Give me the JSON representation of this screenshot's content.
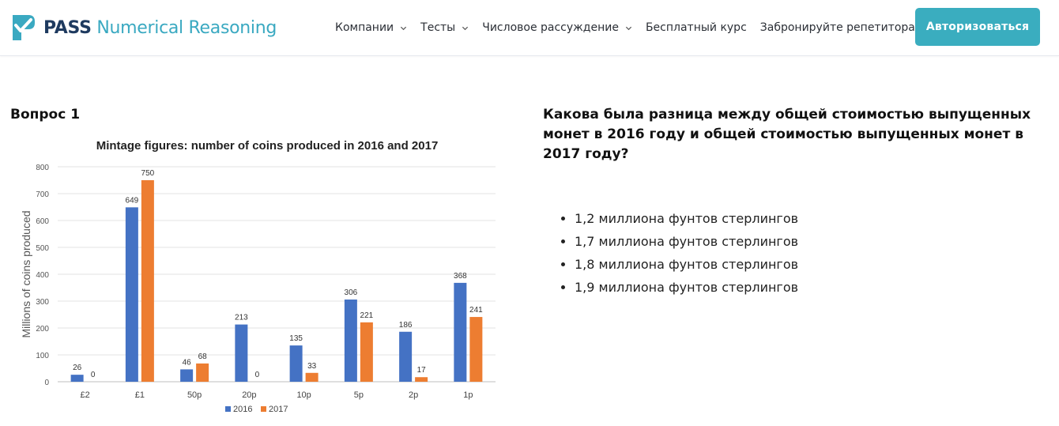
{
  "brand": {
    "pass": "PASS",
    "rest": "Numerical Reasoning",
    "accent": "#3aa9c1",
    "dark": "#1e3a5f"
  },
  "nav": [
    {
      "label": "Компании",
      "dropdown": true
    },
    {
      "label": "Тесты",
      "dropdown": true
    },
    {
      "label": "Числовое рассуждение",
      "dropdown": true
    },
    {
      "label": "Бесплатный курс",
      "dropdown": false
    },
    {
      "label": "Забронируйте репетитора",
      "dropdown": false
    }
  ],
  "login_label": "Авторизоваться",
  "question_label": "Вопрос 1",
  "question_text": "Какова была разница между общей стоимостью выпущенных монет в 2016 году и общей стоимостью выпущенных монет в 2017 году?",
  "answers": [
    "1,2 миллиона фунтов стерлингов",
    "1,7 миллиона фунтов стерлингов",
    "1,8 миллиона фунтов стерлингов",
    "1,9 миллиона фунтов стерлингов"
  ],
  "chart_data": {
    "type": "bar",
    "title": "Mintage figures:  number of coins produced in 2016 and 2017",
    "xlabel": "",
    "ylabel": "Millions of coins produced",
    "ylim": [
      0,
      800
    ],
    "yticks": [
      0,
      100,
      200,
      300,
      400,
      500,
      600,
      700,
      800
    ],
    "categories": [
      "£2",
      "£1",
      "50p",
      "20p",
      "10p",
      "5p",
      "2p",
      "1p"
    ],
    "series": [
      {
        "name": "2016",
        "color": "#4472c4",
        "values": [
          26,
          649,
          46,
          213,
          135,
          306,
          186,
          368
        ]
      },
      {
        "name": "2017",
        "color": "#ed7d31",
        "values": [
          0,
          750,
          68,
          0,
          33,
          221,
          17,
          241
        ]
      }
    ],
    "grid": true,
    "legend": "bottom"
  }
}
